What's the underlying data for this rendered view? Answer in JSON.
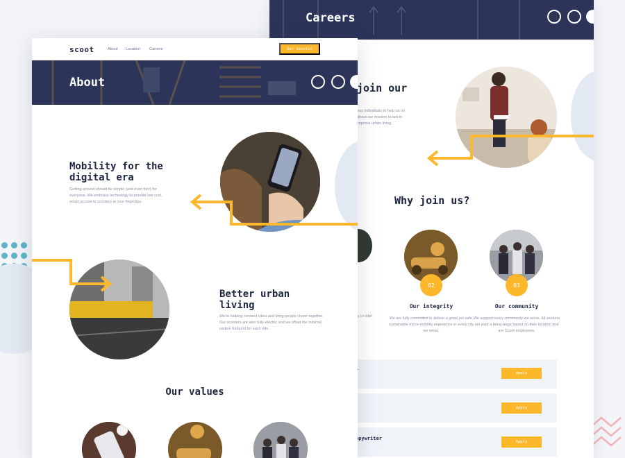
{
  "front_page": {
    "logo": "scoot",
    "nav_links": [
      "About",
      "Location",
      "Careers"
    ],
    "cta": "Get Scootin",
    "hero_title": "About",
    "mobility": {
      "heading": "Mobility for the digital era",
      "text": "Getting around should be simple (and even fun!) for everyone. We embrace technology to provide low cost, smart access to scooters at your fingertips."
    },
    "better": {
      "heading": "Better urban living",
      "text": "We're helping connect cities and bring people closer together. Our scooters are also fully-electric and we offset the minimal carbon footprint for each ride."
    },
    "values_heading": "Our values"
  },
  "back_page": {
    "hero_title": "Careers",
    "join_heading": "join our",
    "join_text": "ous individuals to help us on about our mission to tart to improve urban living.",
    "why_heading": "Why join us?",
    "values": [
      {
        "number": "02",
        "title": "Our integrity",
        "text": "We are fully committed to deliver a great yet safe, sustainable micro-mobility experience in every city we serve."
      },
      {
        "number": "03",
        "title": "Our community",
        "text": "We support every community we serve. All workers are paid a living wage based on their location and are Scoot employees."
      }
    ],
    "left_value_text": "nology to drive ng forward. Our joy to ride!",
    "jobs": [
      {
        "title": "r",
        "apply": "Apply"
      },
      {
        "title": "",
        "apply": "Apply"
      },
      {
        "title": "opywriter",
        "apply": "Apply"
      }
    ]
  },
  "colors": {
    "navy": "#2C3559",
    "yellow": "#FCB72B",
    "teal": "#5FB4C8",
    "light_blue": "#E3E9F2"
  }
}
